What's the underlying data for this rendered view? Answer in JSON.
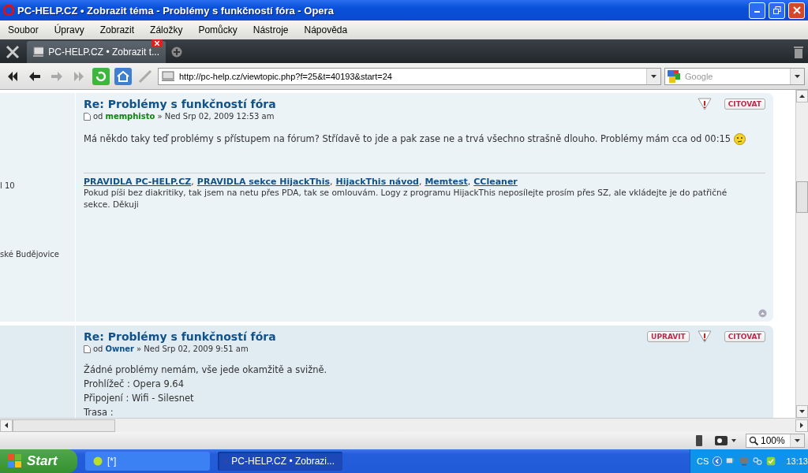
{
  "window": {
    "title": "PC-HELP.CZ • Zobrazit téma - Problémy s funkčností fóra - Opera"
  },
  "menu": [
    "Soubor",
    "Úpravy",
    "Zobrazit",
    "Záložky",
    "Pomůcky",
    "Nástroje",
    "Nápověda"
  ],
  "tabs": [
    {
      "label": "PC-HELP.CZ • Zobrazit t...",
      "selected": true
    }
  ],
  "address": {
    "value": "http://pc-help.cz/viewtopic.php?f=25&t=40193&start=24"
  },
  "search": {
    "placeholder": "Google"
  },
  "sidebar_fragments": [
    "l 10",
    "ské Budějovice"
  ],
  "posts": [
    {
      "title": "Re: Problémy s funkčností fóra",
      "prefix": "od",
      "author": "memphisto",
      "color": "#10860f",
      "date": "» Ned Srp 02, 2009 12:53 am",
      "buttons": [
        {
          "kind": "report"
        },
        {
          "kind": "quote",
          "label": "CITOVAT"
        }
      ],
      "body": [
        "Má někdo taky teď problémy s přístupem na fórum? Střídavě to jde a pak zase ne a trvá všechno strašně dlouho. Problémy mám cca od 00:15"
      ],
      "smiley": true,
      "signature": {
        "links": [
          {
            "label": "PRAVIDLA PC-HELP.CZ",
            "separator": ","
          },
          {
            "label": "PRAVIDLA sekce HijackThis",
            "separator": ","
          },
          {
            "label": "HijackThis návod",
            "separator": ","
          },
          {
            "label": "Memtest",
            "separator": ","
          },
          {
            "label": "CCleaner"
          }
        ],
        "text": "Pokud píši bez diakritiky, tak jsem na netu přes PDA, tak se omlouvám. Logy z programu HijackThis neposílejte prosím přes SZ, ale vkládejte je do patřičné sekce. Děkuji"
      }
    },
    {
      "title": "Re: Problémy s funkčností fóra",
      "prefix": "od",
      "author": "Owner",
      "color": "#105289",
      "date": "» Ned Srp 02, 2009 9:51 am",
      "buttons": [
        {
          "kind": "edit",
          "label": "UPRAVIT"
        },
        {
          "kind": "report"
        },
        {
          "kind": "quote",
          "label": "CITOVAT"
        }
      ],
      "body": [
        "Žádné problémy nemám, vše jede okamžitě a svižně.",
        "Prohlížeč : Opera 9.64",
        "Připojení : Wifi - Silesnet",
        "Trasa :"
      ],
      "smiley": false
    }
  ],
  "status": {
    "zoom": "100%"
  },
  "taskbar": {
    "start": "Start",
    "tasks": [
      {
        "label": "[*]",
        "selected": false
      },
      {
        "label": "PC-HELP.CZ • Zobrazi...",
        "selected": true
      }
    ],
    "language": "CS",
    "clock": "13:13"
  }
}
